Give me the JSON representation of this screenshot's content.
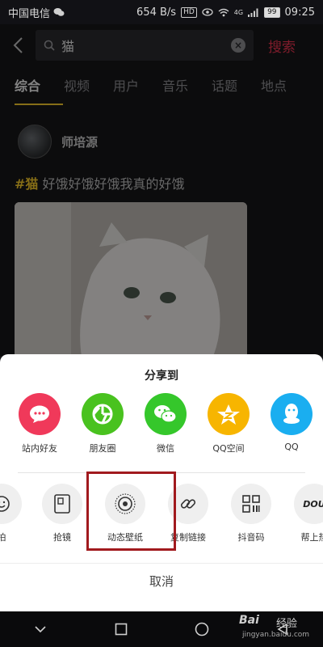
{
  "status_bar": {
    "carrier": "中国电信",
    "speed": "654 B/s",
    "hd": "HD",
    "network": "4G",
    "battery": "99",
    "time": "09:25"
  },
  "search": {
    "query": "猫",
    "button": "搜索"
  },
  "tabs": [
    {
      "label": "综合",
      "active": true
    },
    {
      "label": "视频",
      "active": false
    },
    {
      "label": "用户",
      "active": false
    },
    {
      "label": "音乐",
      "active": false
    },
    {
      "label": "话题",
      "active": false
    },
    {
      "label": "地点",
      "active": false
    }
  ],
  "post": {
    "author": "师培源",
    "hashtag": "#猫",
    "caption": " 好饿好饿好饿我真的好饿"
  },
  "share_sheet": {
    "title": "分享到",
    "apps": [
      {
        "label": "站内好友",
        "icon": "chat-bubble-icon",
        "color": "#f0395a"
      },
      {
        "label": "朋友圈",
        "icon": "moments-icon",
        "color": "#49c21f"
      },
      {
        "label": "微信",
        "icon": "wechat-icon",
        "color": "#35c72b"
      },
      {
        "label": "QQ空间",
        "icon": "qzone-icon",
        "color": "#f7b500"
      },
      {
        "label": "QQ",
        "icon": "qq-icon",
        "color": "#1aaef0"
      }
    ],
    "tools": [
      {
        "label": "拍",
        "icon": "smile-icon"
      },
      {
        "label": "抢镜",
        "icon": "duet-icon"
      },
      {
        "label": "动态壁纸",
        "icon": "live-wallpaper-icon"
      },
      {
        "label": "复制链接",
        "icon": "link-icon"
      },
      {
        "label": "抖音码",
        "icon": "qr-code-icon"
      },
      {
        "label": "帮上热",
        "icon": "dou-plus-icon",
        "badge": "DOU"
      }
    ],
    "cancel": "取消"
  },
  "watermark": {
    "brand": "Bai",
    "brand_cn": "经验",
    "url": "jingyan.baidu.com"
  }
}
